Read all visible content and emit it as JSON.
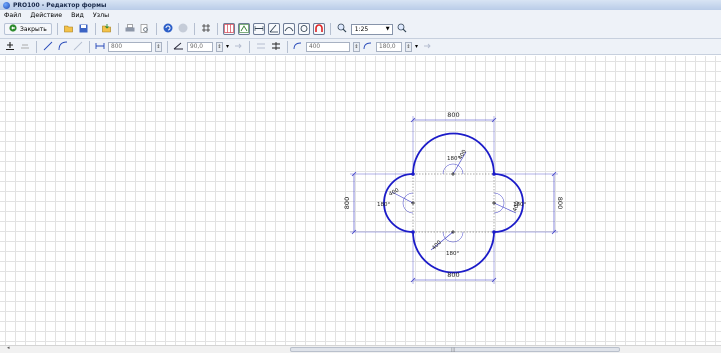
{
  "window": {
    "title": "PRO100 - Редактор формы"
  },
  "menu": {
    "items": [
      "Файл",
      "Действие",
      "Вид",
      "Узлы"
    ]
  },
  "toolbar": {
    "close_label": "Закрыть",
    "scale_value": "1:25"
  },
  "toolbar2": {
    "length_value": "800",
    "angle_value": "90,0",
    "radius_value": "400",
    "arc_angle_value": "180,0"
  },
  "drawing": {
    "color": "#1b1bc8",
    "dimensions": {
      "top_width": "800",
      "bottom_width": "800",
      "left_height": "800",
      "right_height": "800"
    },
    "arcs": {
      "top": {
        "radius": "400",
        "angle": "180°"
      },
      "left": {
        "radius": "400",
        "angle": "180°"
      },
      "right": {
        "radius": "400",
        "angle": "180°"
      },
      "bottom": {
        "radius": "400",
        "angle": "180°"
      }
    }
  },
  "icons": [
    "close-icon",
    "open-icon",
    "save-icon",
    "print-icon",
    "undo-icon",
    "grid-icon",
    "zoom-icon"
  ]
}
